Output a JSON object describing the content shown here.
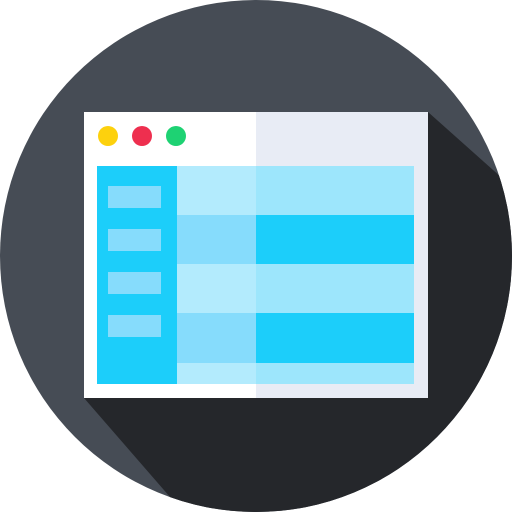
{
  "icon": {
    "name": "browser-window-layout-icon",
    "colors": {
      "circle": "#464c55",
      "shadow": "#25272b",
      "window_left": "#ffffff",
      "window_right": "#e8ecf5",
      "sidebar": "#1ccefa",
      "sidebar_item": "#86dcfc",
      "row_light": "#b3ebfd",
      "row_mid": "#9de6fc",
      "row_blue": "#86dcfc",
      "row_strong": "#1ccefa",
      "dot_yellow": "#fdd10d",
      "dot_red": "#ee2f4f",
      "dot_green": "#1ed273"
    }
  }
}
